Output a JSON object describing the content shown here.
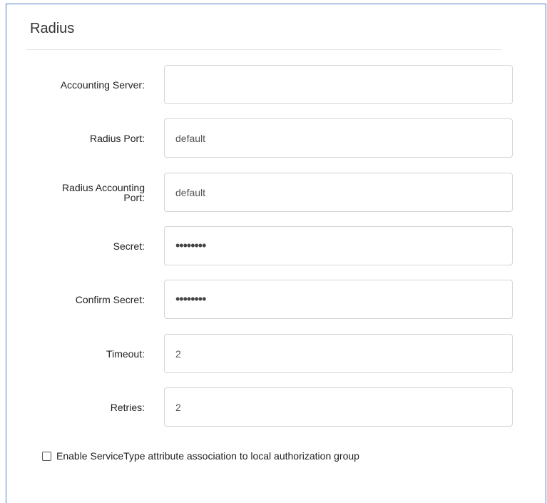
{
  "section": {
    "title": "Radius"
  },
  "form": {
    "accounting_server": {
      "label": "Accounting Server:",
      "value": ""
    },
    "radius_port": {
      "label": "Radius Port:",
      "value": "default"
    },
    "radius_accounting_port": {
      "label_line1": "Radius Accounting",
      "label_line2": "Port:",
      "value": "default"
    },
    "secret": {
      "label": "Secret:",
      "value": "••••••••"
    },
    "confirm_secret": {
      "label": "Confirm Secret:",
      "value": "••••••••"
    },
    "timeout": {
      "label": "Timeout:",
      "value": "2"
    },
    "retries": {
      "label": "Retries:",
      "value": "2"
    }
  },
  "service_type": {
    "checked": false,
    "label": "Enable ServiceType attribute association to local authorization group"
  }
}
